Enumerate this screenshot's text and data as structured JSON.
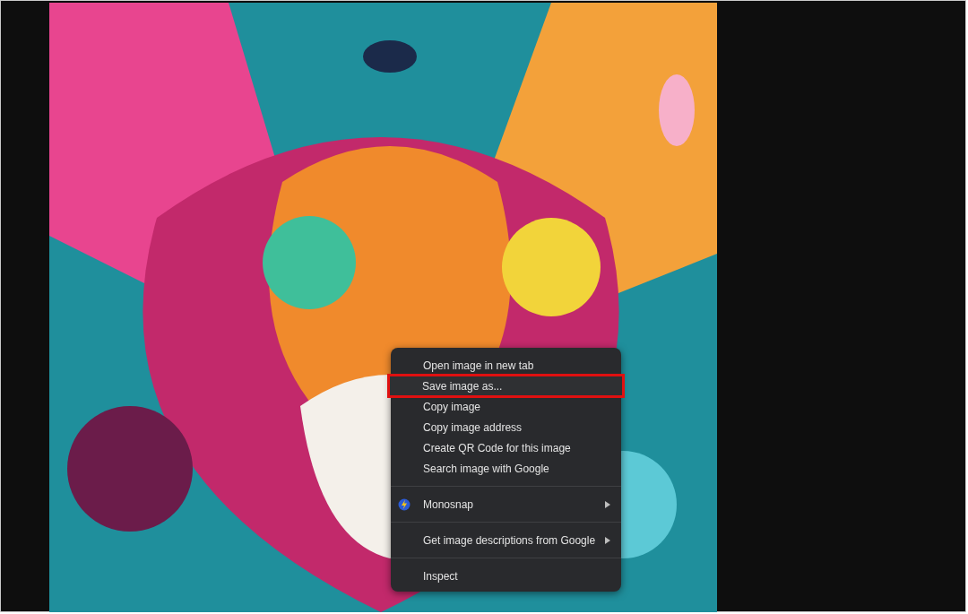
{
  "context_menu": {
    "groups": [
      {
        "items": [
          {
            "label": "Open image in new tab",
            "selected": false,
            "submenu": false,
            "kind": "plain"
          },
          {
            "label": "Save image as...",
            "selected": true,
            "submenu": false,
            "kind": "plain"
          },
          {
            "label": "Copy image",
            "selected": false,
            "submenu": false,
            "kind": "plain"
          },
          {
            "label": "Copy image address",
            "selected": false,
            "submenu": false,
            "kind": "plain"
          },
          {
            "label": "Create QR Code for this image",
            "selected": false,
            "submenu": false,
            "kind": "plain"
          },
          {
            "label": "Search image with Google",
            "selected": false,
            "submenu": false,
            "kind": "plain"
          }
        ]
      },
      {
        "items": [
          {
            "label": "Monosnap",
            "selected": false,
            "submenu": true,
            "kind": "app"
          }
        ]
      },
      {
        "items": [
          {
            "label": "Get image descriptions from Google",
            "selected": false,
            "submenu": true,
            "kind": "plain"
          }
        ]
      },
      {
        "items": [
          {
            "label": "Inspect",
            "selected": false,
            "submenu": false,
            "kind": "plain"
          }
        ]
      }
    ]
  }
}
